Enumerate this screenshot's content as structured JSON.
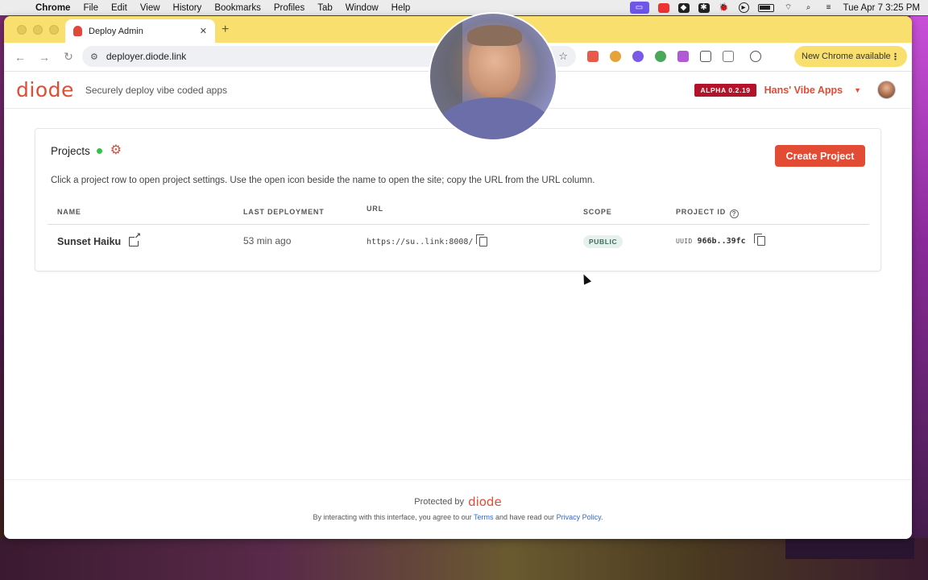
{
  "menubar": {
    "app": "Chrome",
    "items": [
      "File",
      "Edit",
      "View",
      "History",
      "Bookmarks",
      "Profiles",
      "Tab",
      "Window",
      "Help"
    ],
    "clock": "Tue Apr 7  3:25 PM"
  },
  "browser": {
    "tab_title": "Deploy Admin",
    "url": "deployer.diode.link",
    "new_chrome_label": "New Chrome available"
  },
  "app": {
    "logo": "diode",
    "tagline": "Securely deploy vibe coded apps",
    "version_badge": "ALPHA 0.2.19",
    "workspace": "Hans' Vibe Apps"
  },
  "projects": {
    "title": "Projects",
    "create_button": "Create Project",
    "hint": "Click a project row to open project settings. Use the open icon beside the name to open the site; copy the URL from the URL column.",
    "columns": {
      "name": "NAME",
      "last_deployment": "LAST DEPLOYMENT",
      "url": "URL",
      "scope": "SCOPE",
      "project_id": "PROJECT ID"
    },
    "rows": [
      {
        "name": "Sunset Haiku",
        "last_deployment": "53 min ago",
        "url": "https://su..link:8008/",
        "scope": "PUBLIC",
        "id_label": "UUID",
        "id_value": "966b..39fc"
      }
    ]
  },
  "footer": {
    "protected_by": "Protected by",
    "logo": "diode",
    "legal_prefix": "By interacting with this interface, you agree to our",
    "terms": "Terms",
    "legal_middle": "and have read our",
    "privacy": "Privacy Policy",
    "legal_suffix": "."
  },
  "colors": {
    "brand": "#e24b34",
    "badge": "#b3122b",
    "status_online": "#35c04b",
    "chrome_theme": "#f9e06e"
  }
}
